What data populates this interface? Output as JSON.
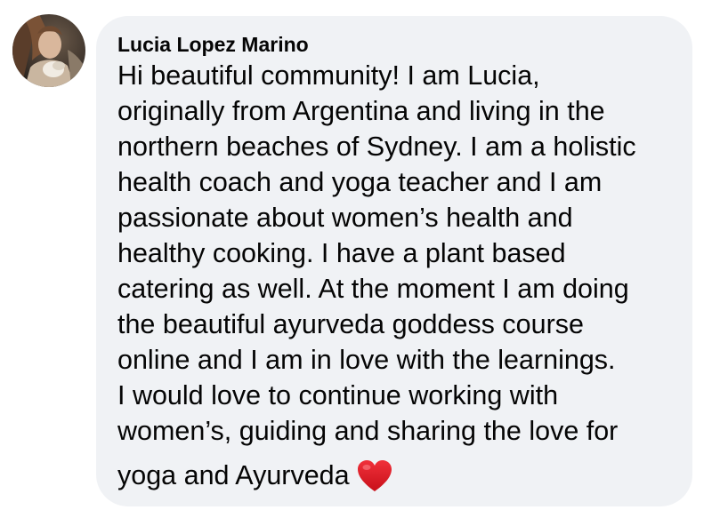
{
  "comment": {
    "author": "Lucia Lopez Marino",
    "lines": [
      "Hi beautiful community! I am Lucia,",
      "originally from Argentina and living in the",
      "northern beaches of Sydney. I am a holistic",
      "health coach and yoga teacher and I am",
      "passionate about women’s health and",
      "healthy cooking. I have a plant based",
      "catering as well. At the moment I am doing",
      "the beautiful ayurveda goddess course",
      "online and I am in love with the learnings.",
      "I would love to continue working with",
      "women’s, guiding and sharing the love for",
      "yoga and Ayurveda"
    ],
    "trailing_emoji": "red-heart-icon"
  },
  "colors": {
    "bubble_background": "#f0f2f5",
    "text": "#050505",
    "heart": "#e0141e"
  }
}
